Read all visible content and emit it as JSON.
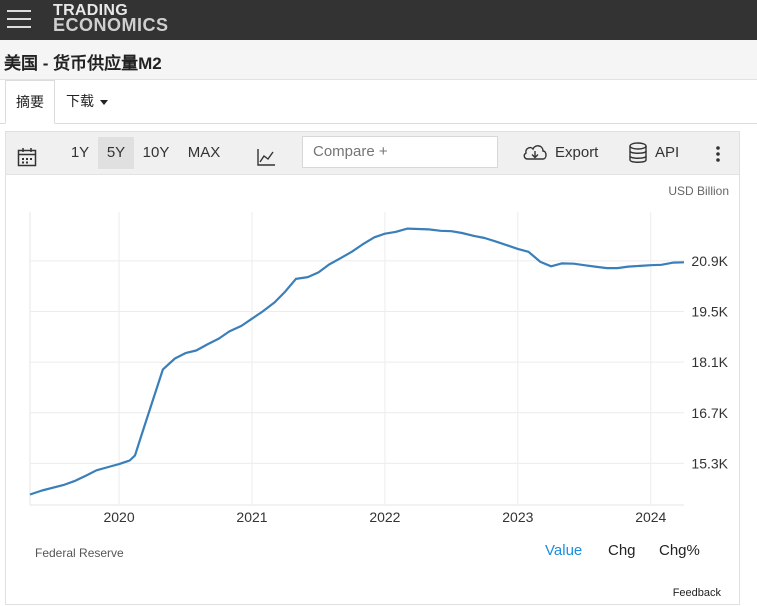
{
  "header": {
    "logo_line1": "TRADING",
    "logo_line2": "ECONOMICS"
  },
  "page": {
    "title": "美国 - 货币供应量M2"
  },
  "tabs": {
    "summary": "摘要",
    "download": "下载"
  },
  "toolbar": {
    "range_1y": "1Y",
    "range_5y": "5Y",
    "range_10y": "10Y",
    "range_max": "MAX",
    "compare_placeholder": "Compare +",
    "export": "Export",
    "api": "API",
    "icons": [
      "calendar-icon",
      "line-chart-icon",
      "cloud-download-icon",
      "database-icon",
      "more-vert-icon"
    ]
  },
  "chart": {
    "units": "USD Billion",
    "source": "Federal Reserve"
  },
  "views": {
    "value": "Value",
    "chg": "Chg",
    "chgpct": "Chg%"
  },
  "feedback": "Feedback",
  "colors": {
    "line": "#3a7fb9",
    "active_view": "#1a8ee0"
  },
  "chart_data": {
    "type": "line",
    "title": "",
    "xlabel": "",
    "ylabel": "USD Billion",
    "x_ticks": [
      "2020",
      "2021",
      "2022",
      "2023",
      "2024"
    ],
    "y_ticks": [
      "15.3K",
      "16.7K",
      "18.1K",
      "19.5K",
      "20.9K"
    ],
    "y_tick_values": [
      15300,
      16700,
      18100,
      19500,
      20900
    ],
    "xlim": [
      2019.33,
      2024.25
    ],
    "ylim": [
      14150,
      22250
    ],
    "grid": true,
    "series": [
      {
        "values": [
          [
            2019.33,
            14440
          ],
          [
            2019.42,
            14550
          ],
          [
            2019.58,
            14700
          ],
          [
            2019.67,
            14820
          ],
          [
            2019.75,
            14960
          ],
          [
            2019.83,
            15110
          ],
          [
            2019.92,
            15200
          ],
          [
            2020.0,
            15280
          ],
          [
            2020.08,
            15380
          ],
          [
            2020.12,
            15520
          ],
          [
            2020.17,
            16100
          ],
          [
            2020.25,
            17000
          ],
          [
            2020.33,
            17900
          ],
          [
            2020.42,
            18200
          ],
          [
            2020.5,
            18350
          ],
          [
            2020.58,
            18420
          ],
          [
            2020.67,
            18600
          ],
          [
            2020.75,
            18750
          ],
          [
            2020.83,
            18950
          ],
          [
            2020.92,
            19100
          ],
          [
            2021.0,
            19300
          ],
          [
            2021.08,
            19500
          ],
          [
            2021.17,
            19750
          ],
          [
            2021.25,
            20050
          ],
          [
            2021.33,
            20400
          ],
          [
            2021.42,
            20450
          ],
          [
            2021.5,
            20580
          ],
          [
            2021.58,
            20800
          ],
          [
            2021.67,
            20980
          ],
          [
            2021.75,
            21150
          ],
          [
            2021.83,
            21350
          ],
          [
            2021.92,
            21550
          ],
          [
            2022.0,
            21650
          ],
          [
            2022.08,
            21700
          ],
          [
            2022.17,
            21790
          ],
          [
            2022.25,
            21780
          ],
          [
            2022.33,
            21770
          ],
          [
            2022.42,
            21730
          ],
          [
            2022.5,
            21720
          ],
          [
            2022.58,
            21670
          ],
          [
            2022.67,
            21590
          ],
          [
            2022.75,
            21530
          ],
          [
            2022.83,
            21440
          ],
          [
            2022.92,
            21330
          ],
          [
            2023.0,
            21230
          ],
          [
            2023.08,
            21150
          ],
          [
            2023.17,
            20870
          ],
          [
            2023.25,
            20750
          ],
          [
            2023.33,
            20830
          ],
          [
            2023.42,
            20820
          ],
          [
            2023.5,
            20780
          ],
          [
            2023.58,
            20740
          ],
          [
            2023.67,
            20700
          ],
          [
            2023.75,
            20700
          ],
          [
            2023.83,
            20740
          ],
          [
            2023.92,
            20760
          ],
          [
            2024.0,
            20780
          ],
          [
            2024.08,
            20790
          ],
          [
            2024.17,
            20850
          ],
          [
            2024.25,
            20860
          ]
        ]
      }
    ]
  }
}
